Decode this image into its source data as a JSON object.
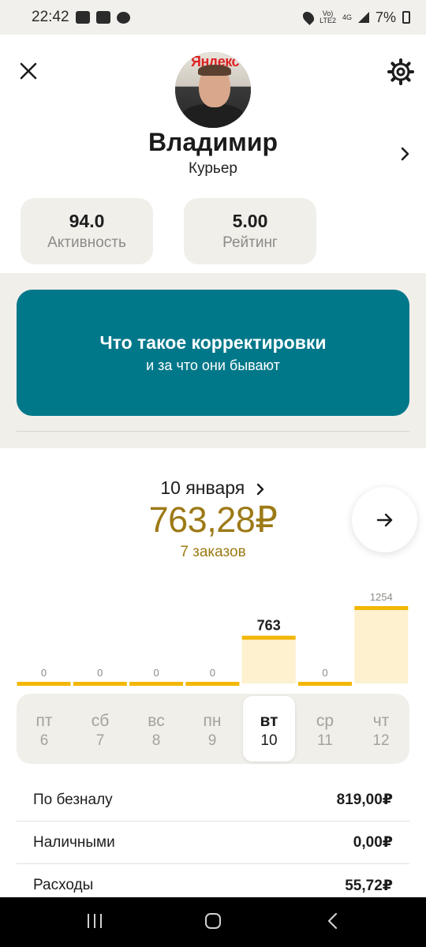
{
  "status_bar": {
    "time": "22:42",
    "network_label_1": "Vo)",
    "network_label_2": "LTE2",
    "network_type": "4G",
    "battery": "7%"
  },
  "header": {
    "close_icon": "close-icon",
    "settings_icon": "gear-icon",
    "avatar_sign": "Яндекс"
  },
  "profile": {
    "name": "Владимир",
    "role": "Курьер"
  },
  "stats": {
    "activity_value": "94.0",
    "activity_label": "Активность",
    "rating_value": "5.00",
    "rating_label": "Рейтинг"
  },
  "promo": {
    "title": "Что такое корректировки",
    "subtitle": "и за что они бывают",
    "background_color": "#01788a"
  },
  "earnings": {
    "date": "10 января",
    "amount": "763,28₽",
    "orders": "7 заказов",
    "accent_color": "#9c7a16"
  },
  "chart_data": {
    "type": "bar",
    "categories": [
      "пт 6",
      "сб 7",
      "вс 8",
      "пн 9",
      "вт 10",
      "ср 11",
      "чт 12"
    ],
    "values": [
      0,
      0,
      0,
      0,
      763,
      0,
      1254
    ],
    "value_labels": [
      "0",
      "0",
      "0",
      "0",
      "763",
      "0",
      "1254"
    ],
    "selected_index": 4,
    "ylim": [
      0,
      1254
    ],
    "bar_color": "#f2b705",
    "fill_color": "#fdf1cf"
  },
  "days": [
    {
      "name": "пт",
      "num": "6"
    },
    {
      "name": "сб",
      "num": "7"
    },
    {
      "name": "вс",
      "num": "8"
    },
    {
      "name": "пн",
      "num": "9"
    },
    {
      "name": "вт",
      "num": "10"
    },
    {
      "name": "ср",
      "num": "11"
    },
    {
      "name": "чт",
      "num": "12"
    }
  ],
  "summary": [
    {
      "label": "По безналу",
      "value": "819,00₽"
    },
    {
      "label": "Наличными",
      "value": "0,00₽"
    },
    {
      "label": "Расходы",
      "value": "55,72₽"
    }
  ]
}
